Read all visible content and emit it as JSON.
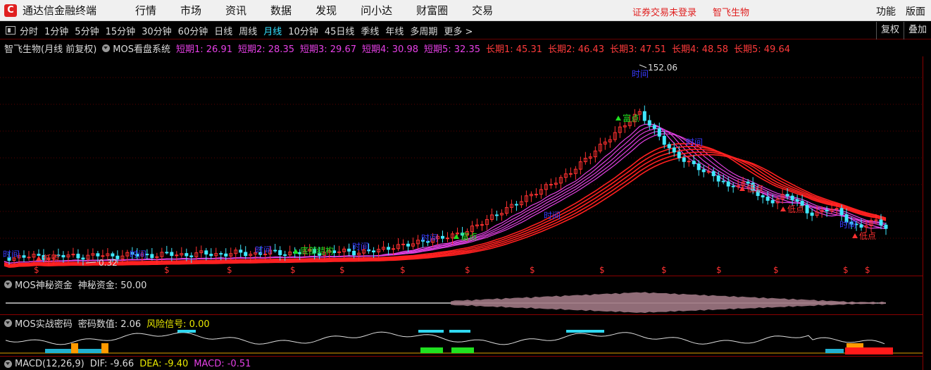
{
  "menubar": {
    "logo_glyph": "C",
    "app_title": "通达信金融终端",
    "items": [
      "行情",
      "市场",
      "资讯",
      "数据",
      "发现",
      "问小达",
      "财富圈",
      "交易"
    ],
    "login_status": "证券交易未登录",
    "stock_name": "智飞生物",
    "right": [
      "功能",
      "版面"
    ]
  },
  "periodbar": {
    "periods": [
      "分时",
      "1分钟",
      "5分钟",
      "15分钟",
      "30分钟",
      "60分钟",
      "日线",
      "周线",
      "月线",
      "10分钟",
      "45日线",
      "季线",
      "年线",
      "多周期",
      "更多 >"
    ],
    "active": "月线",
    "right_buttons": [
      "复权",
      "叠加"
    ]
  },
  "infoline": {
    "title": "智飞生物(月线 前复权)",
    "indicator": "MOS看盘系统",
    "short_terms": [
      "短期1: 26.91",
      "短期2: 28.35",
      "短期3: 29.67",
      "短期4: 30.98",
      "短期5: 32.35"
    ],
    "long_terms": [
      "长期1: 45.31",
      "长期2: 46.43",
      "长期3: 47.51",
      "长期4: 48.58",
      "长期5: 49.64"
    ]
  },
  "chart": {
    "high_label": "152.06",
    "low_label": "0.32",
    "signal_labels": {
      "shidian": "时间",
      "fudian": "富点",
      "didian": "低点",
      "dibuzhuanji": "底部结构",
      "dollar": "$"
    },
    "colors": {
      "up": "#ff3030",
      "down": "#40e8ff",
      "short_ma": "#e040e0",
      "long_ma": "#ff2020",
      "grid": "#5a0000"
    }
  },
  "panel_mystery": {
    "title": "MOS神秘资金",
    "value": "神秘资金: 50.00"
  },
  "panel_password": {
    "title": "MOS实战密码",
    "value": "密码数值: 2.06",
    "risk": "风险信号: 0.00"
  },
  "panel_macd": {
    "title": "MACD(12,26,9)",
    "dif": "DIF: -9.66",
    "dea": "DEA: -9.40",
    "macd": "MACD: -0.51"
  }
}
